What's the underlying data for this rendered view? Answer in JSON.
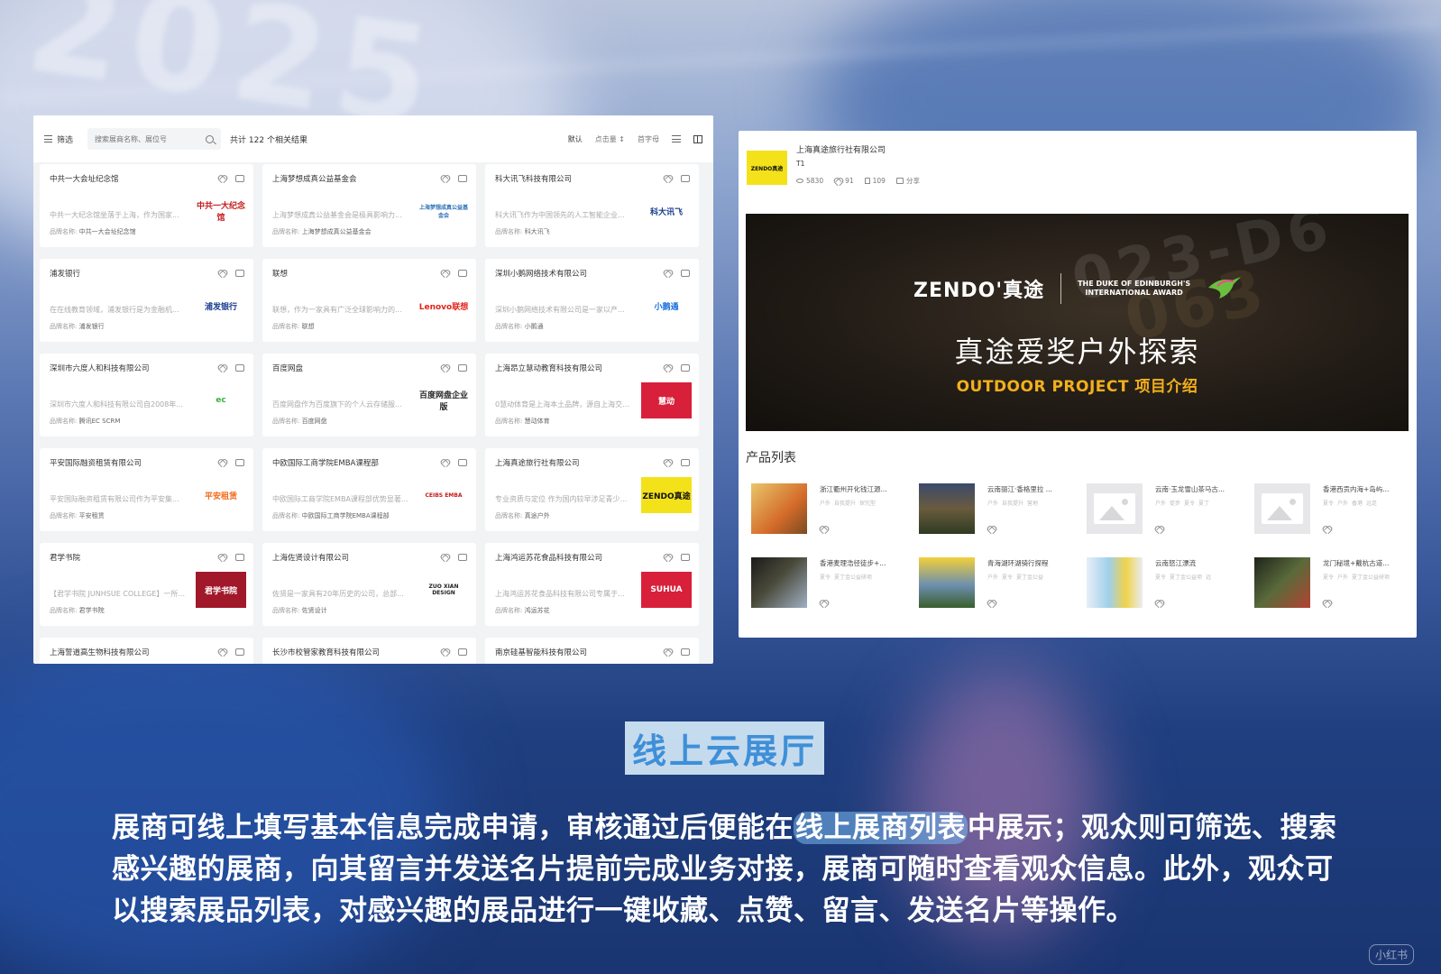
{
  "background": {
    "year_text": "2025"
  },
  "exhibitor_list": {
    "filter_label": "筛选",
    "search_placeholder": "搜索展商名称、展位号",
    "result_prefix": "共计",
    "result_count": "122",
    "result_suffix": "个相关结果",
    "sort_options": [
      "默认",
      "点击量",
      "首字母"
    ],
    "items": [
      {
        "title": "中共一大会址纪念馆",
        "desc": "中共一大纪念馆坐落于上海，作为国家...",
        "brand_label": "品牌名称:",
        "brand": "中共一大会址纪念馆",
        "logo_text": "中共一大纪念馆",
        "logo_color": "#c41a1a"
      },
      {
        "title": "上海梦想成真公益基金会",
        "desc": "上海梦想成真公益基金会是极具影响力...",
        "brand_label": "品牌名称:",
        "brand": "上海梦想成真公益基金会",
        "logo_text": "上海梦想成真公益基金会",
        "logo_color": "#2b6fb6"
      },
      {
        "title": "科大讯飞科技有限公司",
        "desc": "科大讯飞作为中国领先的人工智能企业...",
        "brand_label": "品牌名称:",
        "brand": "科大讯飞",
        "logo_text": "科大讯飞",
        "logo_color": "#1a3d8f"
      },
      {
        "title": "浦发银行",
        "desc": "在在线教育领域，浦发银行是为金融机...",
        "brand_label": "品牌名称:",
        "brand": "浦发银行",
        "logo_text": "浦发银行",
        "logo_color": "#1a3d8f"
      },
      {
        "title": "联想",
        "desc": "联想，作为一家具有广泛全球影响力的...",
        "brand_label": "品牌名称:",
        "brand": "联想",
        "logo_text": "Lenovo联想",
        "logo_color": "#e2231a"
      },
      {
        "title": "深圳小鹅网络技术有限公司",
        "desc": "深圳小鹅网络技术有限公司是一家以产...",
        "brand_label": "品牌名称:",
        "brand": "小鹅通",
        "logo_text": "小鹅通",
        "logo_color": "#1a6fe0"
      },
      {
        "title": "深圳市六度人和科技有限公司",
        "desc": "深圳市六度人和科技有限公司自2008年...",
        "brand_label": "品牌名称:",
        "brand": "腾讯EC SCRM",
        "logo_text": "ec",
        "logo_color": "#3cb043"
      },
      {
        "title": "百度网盘",
        "desc": "百度网盘作为百度旗下的个人云存储服...",
        "brand_label": "品牌名称:",
        "brand": "百度网盘",
        "logo_text": "百度网盘企业版",
        "logo_color": "#2a2a2a"
      },
      {
        "title": "上海昂立慧动教育科技有限公司",
        "desc": "0慧动体育是上海本土品牌，源自上海交...",
        "brand_label": "品牌名称:",
        "brand": "慧动体育",
        "logo_text": "慧动",
        "logo_color": "#d8203a"
      },
      {
        "title": "平安国际融资租赁有限公司",
        "desc": "平安国际融资租赁有限公司作为平安集...",
        "brand_label": "品牌名称:",
        "brand": "平安租赁",
        "logo_text": "平安租赁",
        "logo_color": "#f26b1d"
      },
      {
        "title": "中欧国际工商学院EMBA课程部",
        "desc": "中欧国际工商学院EMBA课程部优势显著...",
        "brand_label": "品牌名称:",
        "brand": "中欧国际工商学院EMBA课程部",
        "logo_text": "CEIBS EMBA",
        "logo_color": "#c41a1a"
      },
      {
        "title": "上海真途旅行社有限公司",
        "desc": "专业资质与定位 作为国内较早涉足青少...",
        "brand_label": "品牌名称:",
        "brand": "真途户外",
        "logo_text": "ZENDO真途",
        "logo_color": "#f3e21a"
      },
      {
        "title": "君学书院",
        "desc": "【君学书院 JUNHSUE COLLEGE】一所...",
        "brand_label": "品牌名称:",
        "brand": "君学书院",
        "logo_text": "君学书院",
        "logo_color": "#a0182a"
      },
      {
        "title": "上海佐贤设计有限公司",
        "desc": "佐贤是一家具有20年历史的公司，总部...",
        "brand_label": "品牌名称:",
        "brand": "佐贤设计",
        "logo_text": "ZUO XIAN DESIGN",
        "logo_color": "#222222"
      },
      {
        "title": "上海鸿运苏花食品科技有限公司",
        "desc": "上海鸿运苏花食品科技有限公司专属于...",
        "brand_label": "品牌名称:",
        "brand": "鸿运苏花",
        "logo_text": "SUHUA",
        "logo_color": "#d8203a"
      },
      {
        "title": "上海誓道高生物科技有限公司"
      },
      {
        "title": "长沙市校管家教育科技有限公司"
      },
      {
        "title": "南京硅基智能科技有限公司"
      }
    ]
  },
  "exhibitor_detail": {
    "company": "上海真途旅行社有限公司",
    "booth": "T1",
    "logo_text": "ZENDO真途",
    "views": "5830",
    "likes": "91",
    "thumbs": "109",
    "share_label": "分享",
    "banner": {
      "brand": "ZENDO'真途",
      "award_line1": "THE DUKE OF EDINBURGH'S",
      "award_line2": "INTERNATIONAL AWARD",
      "title": "真途爱奖户外探索",
      "subtitle": "OUTDOOR PROJECT 项目介绍"
    },
    "products_title": "产品列表",
    "products": [
      {
        "name": "浙江衢州开化钱江源...",
        "tags": [
          "户外",
          "自我提升",
          "探究型"
        ],
        "thumb": "doc-orange"
      },
      {
        "name": "云南丽江·香格里拉 ...",
        "tags": [
          "户外",
          "自我提升",
          "营地"
        ],
        "thumb": "mountain"
      },
      {
        "name": "云南·玉龙雪山茶马古...",
        "tags": [
          "户外",
          "徒步",
          "夏令",
          "夏丁"
        ],
        "thumb": "placeholder"
      },
      {
        "name": "香港西贡内海+岛屿...",
        "tags": [
          "夏令",
          "户外",
          "香港",
          "远足"
        ],
        "thumb": "placeholder"
      },
      {
        "name": "香港麦理浩径徒步+...",
        "tags": [
          "夏令",
          "夏丁金公益研项"
        ],
        "thumb": "dark-photo"
      },
      {
        "name": "青海湖环湖骑行探程",
        "tags": [
          "户外",
          "夏令",
          "夏丁金公益"
        ],
        "thumb": "yellow-lake"
      },
      {
        "name": "云南怒江漂流",
        "tags": [
          "夏令",
          "夏丁金公益项",
          "远"
        ],
        "thumb": "map"
      },
      {
        "name": "龙门秘境+戴杭古道...",
        "tags": [
          "夏令",
          "户外",
          "夏丁金公益研项"
        ],
        "thumb": "forest"
      }
    ]
  },
  "caption": {
    "title": "线上云展厅",
    "text_part1": "展商可线上填写基本信息完成申请，审核通过后便能在",
    "text_highlight": "线上展商列表",
    "text_part2": "中展示；观众则可筛选、搜索感兴趣的展商，向其留言并发送名片提前完成业务对接，展商可随时查看观众信息。此外，观众可以搜索展品列表，对感兴趣的展品进行一键收藏、点赞、留言、发送名片等操作。"
  },
  "watermark": "小红书"
}
